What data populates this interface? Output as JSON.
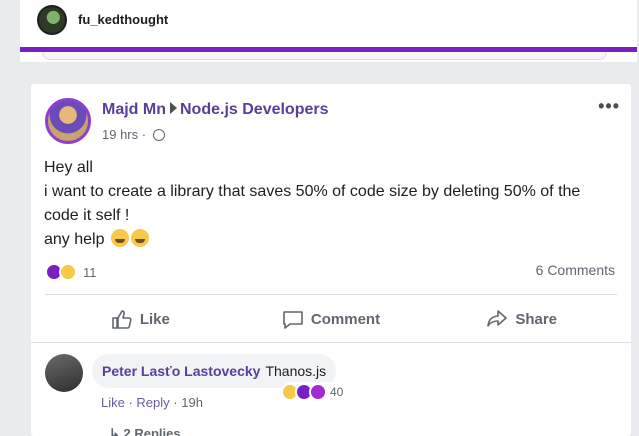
{
  "header": {
    "username": "fu_kedthought"
  },
  "post": {
    "author": "Majd Mn",
    "group": "Node.js Developers",
    "time": "19 hrs · ",
    "more_label": "•••",
    "lines": [
      "Hey all",
      "i want to create a library that saves 50% of code size by deleting 50% of the code it self !",
      "any help"
    ],
    "reaction_count": "11",
    "comments_label": "6 Comments"
  },
  "actions": {
    "like": "Like",
    "comment": "Comment",
    "share": "Share"
  },
  "comment": {
    "author": "Peter Lasťo Lastovecky",
    "text": "Thanos.js",
    "reaction_count": "40",
    "like_label": "Like",
    "reply_label": "Reply",
    "time": "19h",
    "replies_label": "2 Replies"
  },
  "colors": {
    "accent": "#7a1fc4",
    "author": "#5a3e9e",
    "background": "#e9ebee"
  }
}
